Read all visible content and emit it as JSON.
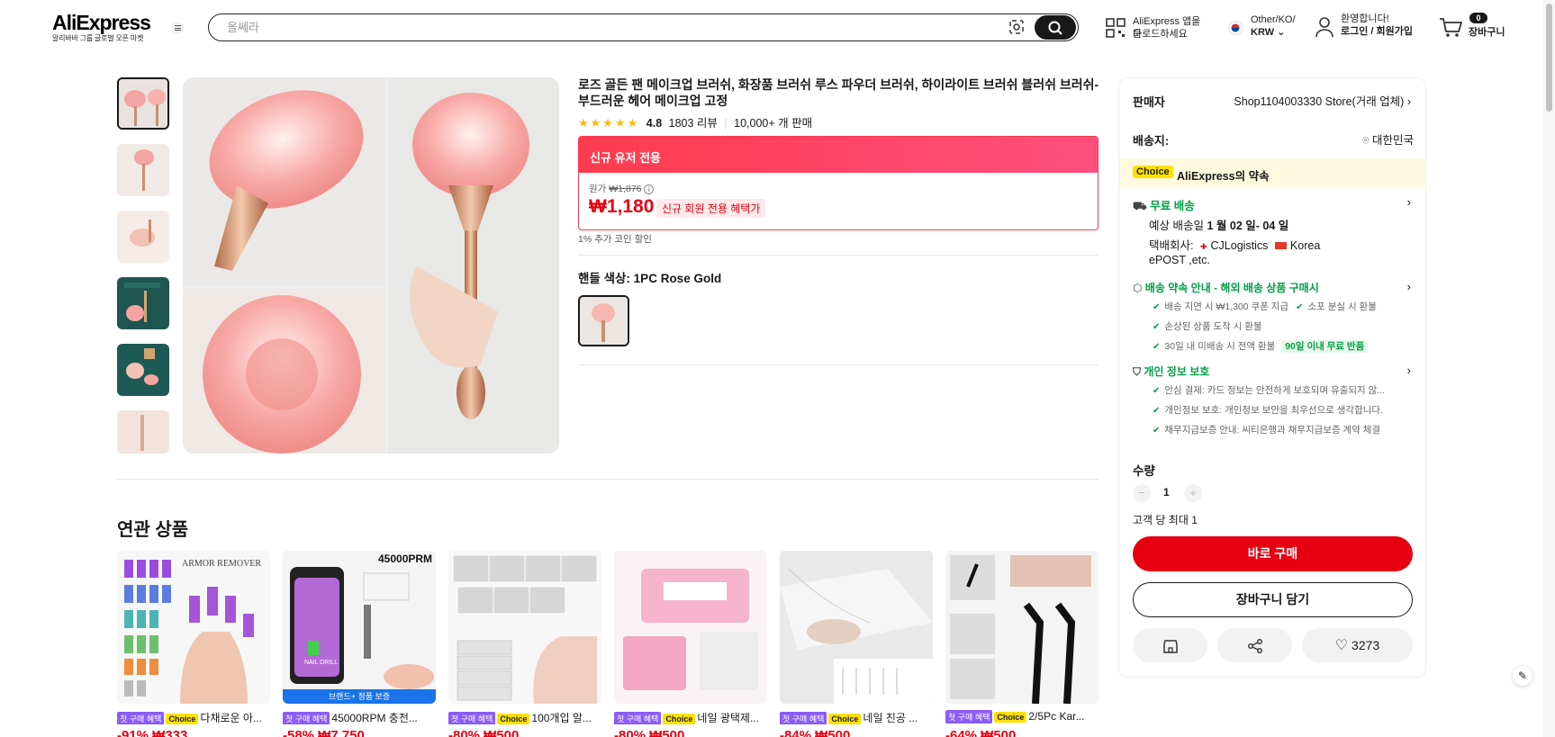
{
  "header": {
    "logo": "AliExpress",
    "logo_sub": "알리바바 그룹 글로벌 오픈 마켓",
    "search_placeholder": "올쎄라",
    "app_line1": "AliExpress 앱을 다",
    "app_line2": "운로드하세요",
    "locale_line1": "Other/KO/",
    "locale_line2": "KRW",
    "account_line1": "환영합니다!",
    "account_line2": "로그인 / 회원가입",
    "cart_count": "0",
    "cart_label": "장바구니"
  },
  "product": {
    "title": "로즈 골든 팬 메이크업 브러쉬, 화장품 브러쉬 루스 파우더 브러쉬, 하이라이트 브러쉬 블러쉬 브러쉬-부드러운 헤어 메이크업 고정",
    "rating": "4.8",
    "rating_stars": 5,
    "reviews": "1803 리뷰",
    "sold": "10,000+ 개 판매",
    "promo_header": "신규 유저 전용",
    "orig_label": "원가",
    "orig_price": "₩1,876",
    "price": "₩1,180",
    "price_badge": "신규 회원 전용 혜택가",
    "coin_note": "1% 추가 코인 할인",
    "color_label": "핸들 색상: 1PC Rose Gold"
  },
  "seller_panel": {
    "seller_label": "판매자",
    "seller_name": "Shop1104003330 Store(거래 업체)",
    "ship_label": "배송지:",
    "ship_to": "대한민국",
    "choice_badge": "Choice",
    "promise_title": "AliExpress의 약속",
    "free_ship": "무료 배송",
    "est_delivery_prefix": "예상 배송일",
    "est_delivery_date": "1 월 02 일- 04 일",
    "carrier_label": "택배회사:",
    "carrier1": "CJLogistics",
    "carrier2": "Korea",
    "carrier3": "ePOST ,etc.",
    "guarantee_title": "배송 약속 안내 - 해외 배송 상품 구매시",
    "guarantee_items": [
      "배송 지연 시 ₩1,300 쿠폰 지급",
      "소포 분실 시 환불",
      "손상된 상품 도착 시 환불",
      "30일 내 미배송 시 전액 환불"
    ],
    "refund_badge": "90일 이내 무료 반품",
    "privacy_title": "개인 정보 보호",
    "privacy_items": [
      "안심 결제: 카드 정보는 안전하게 보호되며 유출되지 않...",
      "개인정보 보호: 개인정보 보안을 최우선으로 생각합니다.",
      "채무지급보증 안내: 씨티은행과 채무지급보증 계약 체결"
    ],
    "qty_label": "수량",
    "qty_value": "1",
    "qty_limit": "고객 당 최대 1",
    "buy_now": "바로 구매",
    "add_cart": "장바구니 담기",
    "wish_count": "3273"
  },
  "related": {
    "title": "연관 상품",
    "first_tag": "첫 구매 혜택",
    "choice_tag": "Choice",
    "brand_banner": "브랜드+ 정품 보증",
    "items": [
      {
        "name": "다채로운 아...",
        "price": "-91% ₩333"
      },
      {
        "name": "45000RPM 충전...",
        "price": "-58% ₩7,750"
      },
      {
        "name": "100개입 알...",
        "price": "-80% ₩500"
      },
      {
        "name": "네일 광택제...",
        "price": "-80% ₩500"
      },
      {
        "name": "네일 진공 ...",
        "price": "-84% ₩500"
      },
      {
        "name": "2/5Pc Kar...",
        "price": "-64% ₩500"
      }
    ]
  },
  "colors": {
    "accent": "#e60012",
    "promo": "#fe3b4e",
    "green": "#00a046",
    "choice": "#ffe100"
  }
}
